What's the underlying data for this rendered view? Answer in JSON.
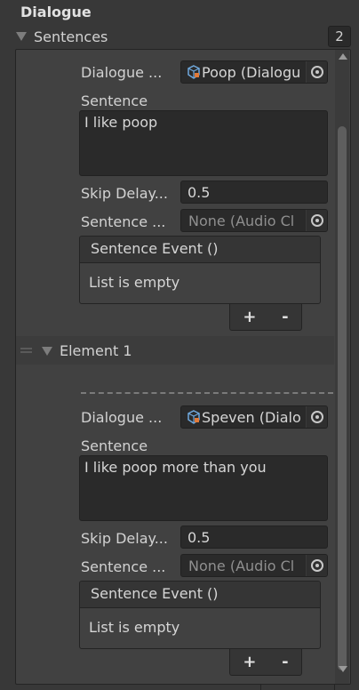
{
  "header": {
    "title": "Dialogue"
  },
  "sentences": {
    "label": "Sentences",
    "count": "2"
  },
  "element0": {
    "dialogue_label": "Dialogue ...",
    "dialogue_value": "Poop (Dialogu",
    "sentence_label": "Sentence",
    "sentence_value": "I like poop",
    "skip_label": "Skip Delay...",
    "skip_value": "0.5",
    "audio_label": "Sentence ...",
    "audio_value": "None (Audio Cl",
    "event_title": "Sentence Event ()",
    "event_empty": "List is empty",
    "plus": "+",
    "minus": "-"
  },
  "element1": {
    "label": "Element 1",
    "dialogue_label": "Dialogue ...",
    "dialogue_value": "Speven (Dialo",
    "sentence_label": "Sentence",
    "sentence_value": "I like poop more than you",
    "skip_label": "Skip Delay...",
    "skip_value": "0.5",
    "audio_label": "Sentence ...",
    "audio_value": "None (Audio Cl",
    "event_title": "Sentence Event ()",
    "event_empty": "List is empty",
    "plus": "+",
    "minus": "-"
  },
  "icons": {
    "scriptable_object": "scriptable-object-icon",
    "object_picker": "object-picker-icon",
    "foldout": "foldout-triangle-icon",
    "drag_handle": "drag-handle-icon"
  },
  "colors": {
    "background": "#383838",
    "panel": "#414141",
    "field": "#2a2a2a",
    "so_icon_orange": "#e07a3a",
    "so_icon_blue": "#6fa8dc"
  }
}
